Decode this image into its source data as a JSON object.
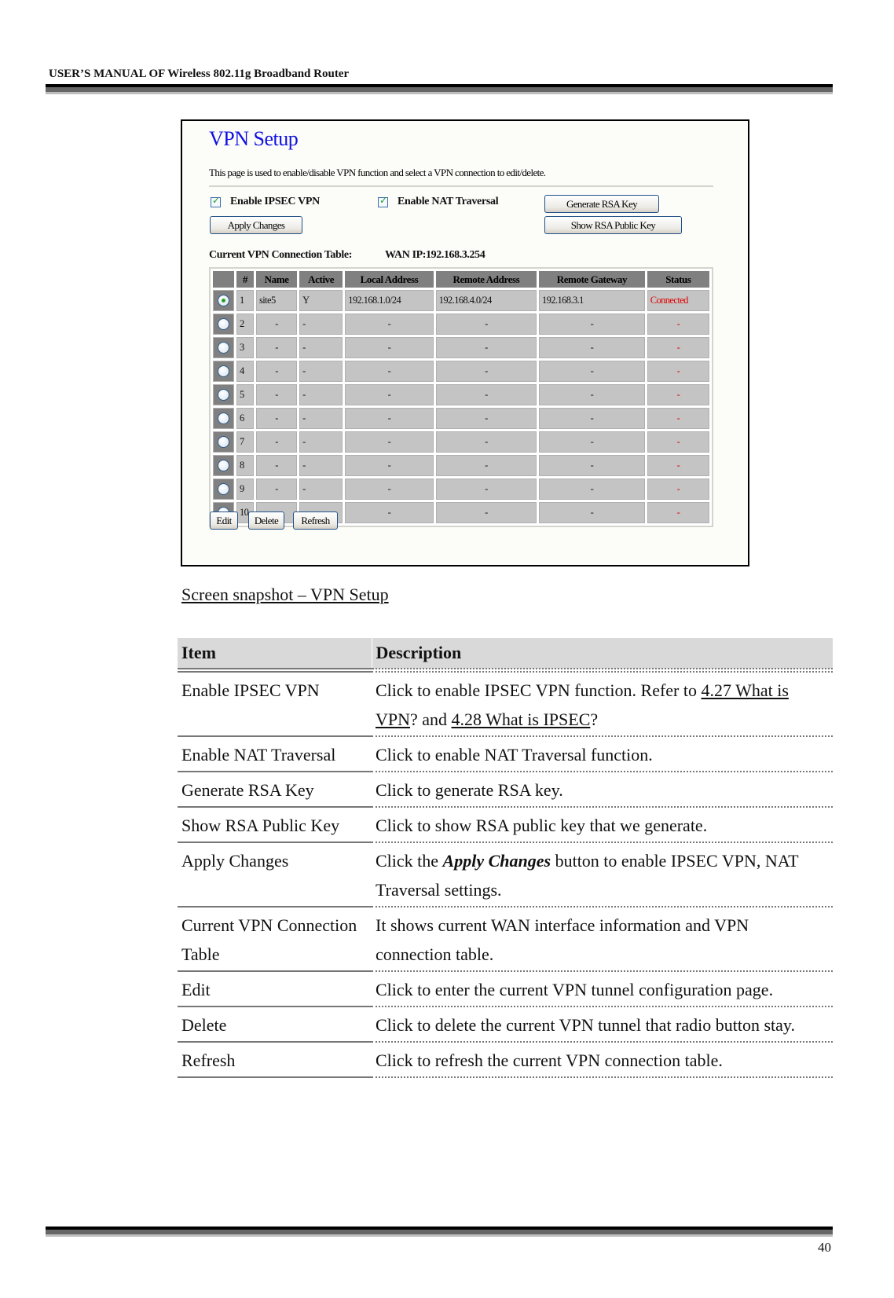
{
  "header": {
    "running_title": "USER’S MANUAL OF Wireless 802.11g Broadband Router"
  },
  "footer": {
    "page_number": "40"
  },
  "screenshot": {
    "title": "VPN Setup",
    "intro": "This page is used to enable/disable VPN function and select a VPN connection to edit/delete.",
    "enable_ipsec": {
      "label": "Enable IPSEC VPN",
      "checked": true
    },
    "enable_nat": {
      "label": "Enable NAT Traversal",
      "checked": true
    },
    "buttons": {
      "apply": "Apply Changes",
      "generate_rsa": "Generate RSA Key",
      "show_rsa": "Show RSA Public Key",
      "edit": "Edit",
      "delete": "Delete",
      "refresh": "Refresh"
    },
    "table_label": "Current VPN Connection Table:",
    "wan_ip": "WAN IP:192.168.3.254",
    "columns": [
      "",
      "#",
      "Name",
      "Active",
      "Local Address",
      "Remote Address",
      "Remote Gateway",
      "Status"
    ],
    "rows": [
      {
        "selected": true,
        "num": "1",
        "name": "site5",
        "active": "Y",
        "local": "192.168.1.0/24",
        "remote": "192.168.4.0/24",
        "gateway": "192.168.3.1",
        "status": "Connected"
      },
      {
        "selected": false,
        "num": "2",
        "name": "-",
        "active": "-",
        "local": "-",
        "remote": "-",
        "gateway": "-",
        "status": "-"
      },
      {
        "selected": false,
        "num": "3",
        "name": "-",
        "active": "-",
        "local": "-",
        "remote": "-",
        "gateway": "-",
        "status": "-"
      },
      {
        "selected": false,
        "num": "4",
        "name": "-",
        "active": "-",
        "local": "-",
        "remote": "-",
        "gateway": "-",
        "status": "-"
      },
      {
        "selected": false,
        "num": "5",
        "name": "-",
        "active": "-",
        "local": "-",
        "remote": "-",
        "gateway": "-",
        "status": "-"
      },
      {
        "selected": false,
        "num": "6",
        "name": "-",
        "active": "-",
        "local": "-",
        "remote": "-",
        "gateway": "-",
        "status": "-"
      },
      {
        "selected": false,
        "num": "7",
        "name": "-",
        "active": "-",
        "local": "-",
        "remote": "-",
        "gateway": "-",
        "status": "-"
      },
      {
        "selected": false,
        "num": "8",
        "name": "-",
        "active": "-",
        "local": "-",
        "remote": "-",
        "gateway": "-",
        "status": "-"
      },
      {
        "selected": false,
        "num": "9",
        "name": "-",
        "active": "-",
        "local": "-",
        "remote": "-",
        "gateway": "-",
        "status": "-"
      },
      {
        "selected": false,
        "num": "10",
        "name": "-",
        "active": "-",
        "local": "-",
        "remote": "-",
        "gateway": "-",
        "status": "-"
      }
    ],
    "colors": {
      "title": "#1010e0",
      "status_red": "#e00000",
      "header_gray": "#808080",
      "cell_gray": "#c4c4c4"
    }
  },
  "caption": "Screen snapshot – VPN Setup",
  "description_table": {
    "headers": {
      "item": "Item",
      "description": "Description"
    },
    "rows": [
      {
        "item": "Enable IPSEC VPN",
        "parts": [
          {
            "text": "Click to enable IPSEC VPN function. Refer to "
          },
          {
            "text": "4.27 What is VPN",
            "style": "link"
          },
          {
            "text": "? and "
          },
          {
            "text": "4.28 What is IPSEC",
            "style": "link"
          },
          {
            "text": "?"
          }
        ]
      },
      {
        "item": "Enable NAT Traversal",
        "parts": [
          {
            "text": "Click to enable NAT Traversal function."
          }
        ]
      },
      {
        "item": "Generate RSA Key",
        "parts": [
          {
            "text": "Click to generate RSA key."
          }
        ]
      },
      {
        "item": "Show RSA Public Key",
        "parts": [
          {
            "text": "Click to show RSA public key that we generate."
          }
        ]
      },
      {
        "item": "Apply Changes",
        "parts": [
          {
            "text": "Click the "
          },
          {
            "text": "Apply Changes",
            "style": "bold-italic"
          },
          {
            "text": " button to enable IPSEC VPN, NAT Traversal settings."
          }
        ]
      },
      {
        "item": "Current VPN Connection Table",
        "parts": [
          {
            "text": "It shows current WAN interface information and VPN connection table."
          }
        ]
      },
      {
        "item": "Edit",
        "parts": [
          {
            "text": "Click to enter the current VPN tunnel configuration page."
          }
        ]
      },
      {
        "item": "Delete",
        "parts": [
          {
            "text": "Click to delete the current VPN tunnel that radio button stay."
          }
        ]
      },
      {
        "item": "Refresh",
        "parts": [
          {
            "text": "Click to refresh the current VPN connection table."
          }
        ]
      }
    ]
  }
}
